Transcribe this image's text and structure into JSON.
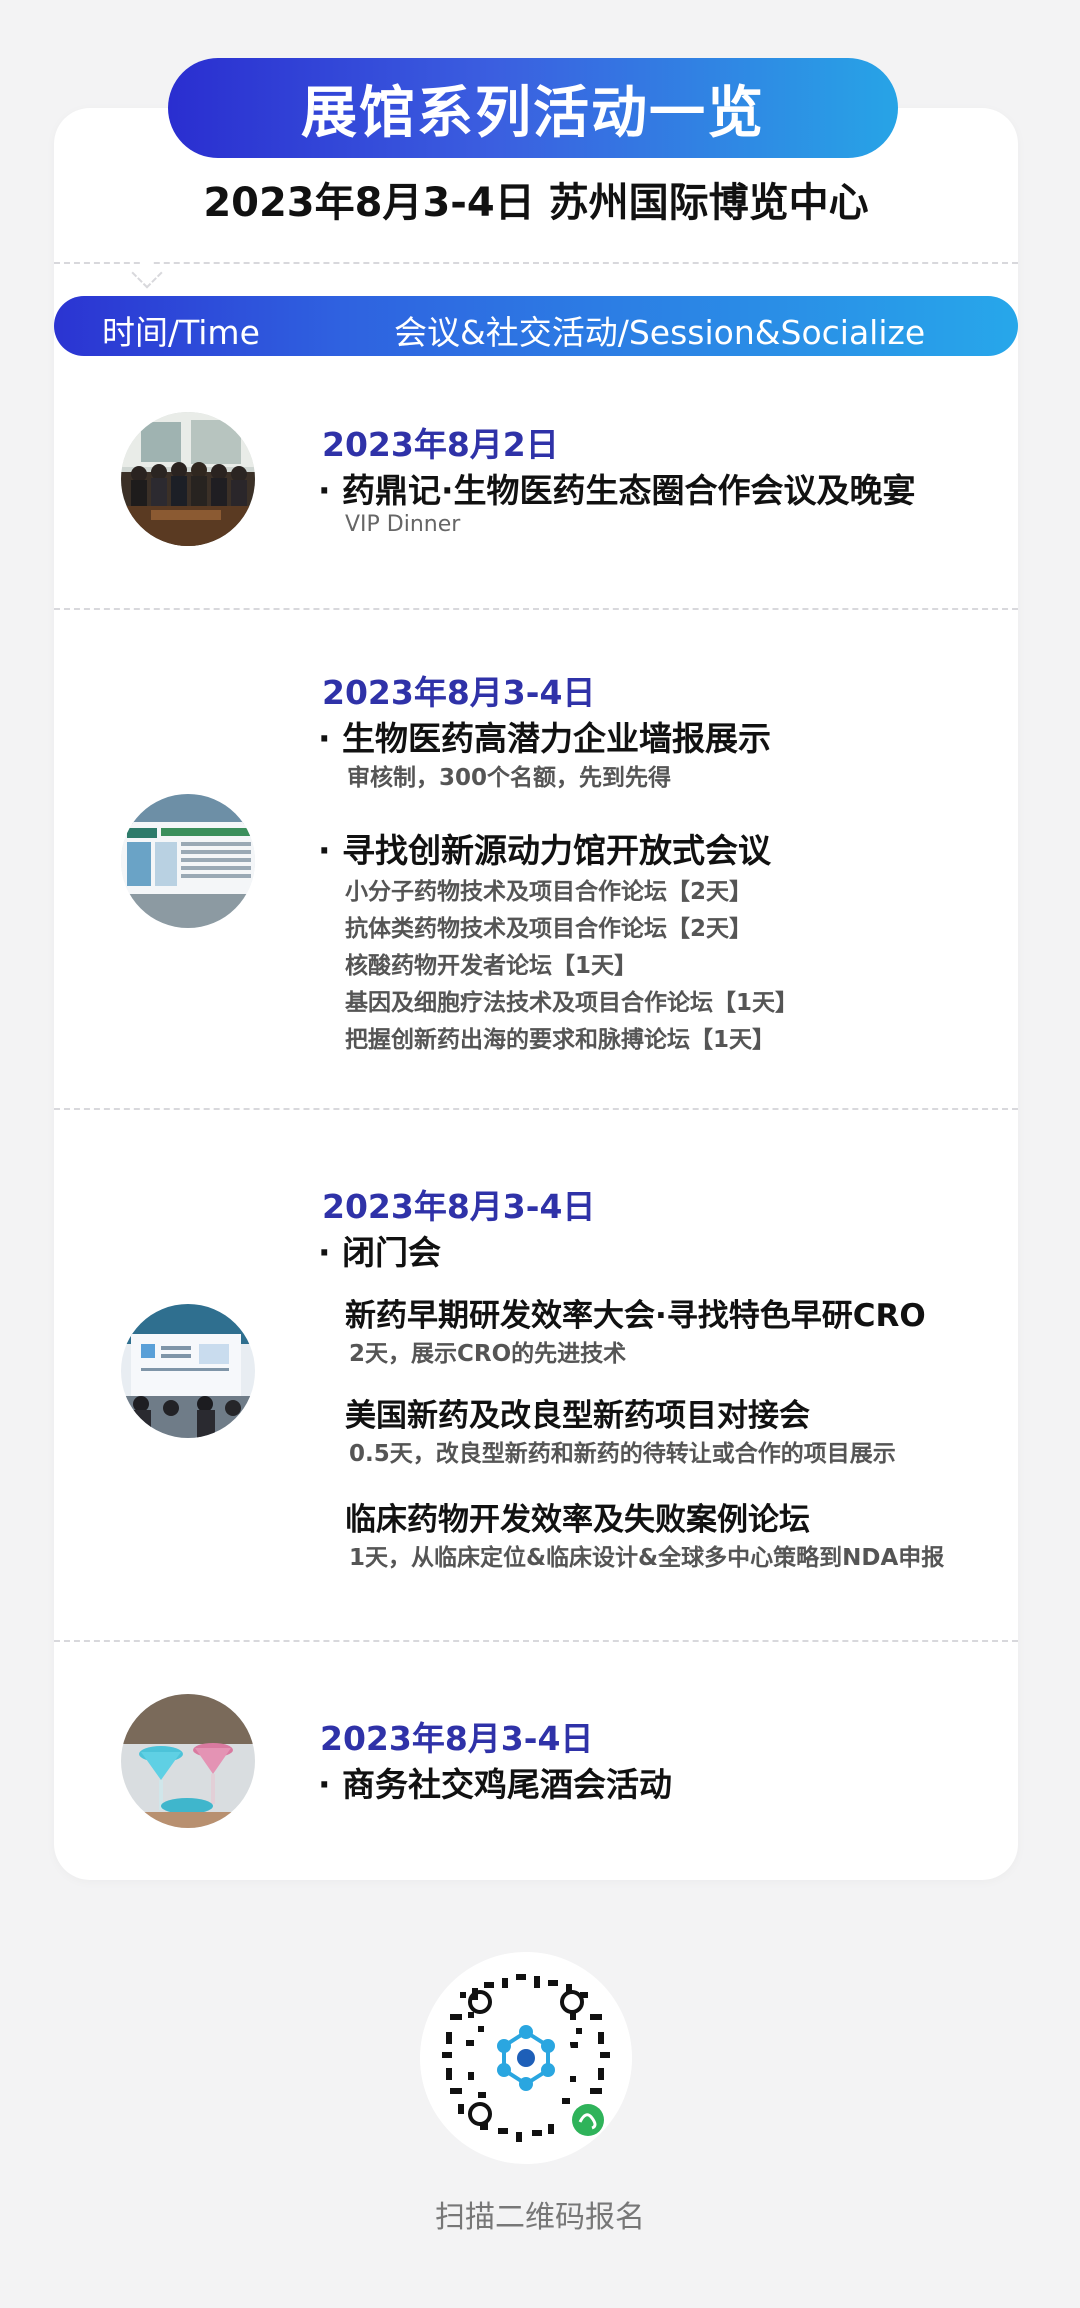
{
  "header": {
    "title": "展馆系列活动一览",
    "subtitle": "2023年8月3-4日  苏州国际博览中心",
    "col_time": "时间/Time",
    "col_session": "会议&社交活动/Session&Socialize"
  },
  "events": [
    {
      "date": "2023年8月2日",
      "title": "药鼎记·生物医药生态圈合作会议及晚宴",
      "sub": "VIP Dinner",
      "thumb_icon": "dinner-photo-icon"
    },
    {
      "date": "2023年8月3-4日",
      "title1": "生物医药高潜力企业墙报展示",
      "sub1": "审核制，300个名额，先到先得",
      "title2": "寻找创新源动力馆开放式会议",
      "forums": [
        "小分子药物技术及项目合作论坛【2天】",
        "抗体类药物技术及项目合作论坛【2天】",
        "核酸药物开发者论坛【1天】",
        "基因及细胞疗法技术及项目合作论坛【1天】",
        "把握创新药出海的要求和脉搏论坛【1天】"
      ],
      "thumb_icon": "poster-wall-photo-icon"
    },
    {
      "date": "2023年8月3-4日",
      "title": "闭门会",
      "meetings": [
        {
          "name": "新药早期研发效率大会·寻找特色早研CRO",
          "desc": "2天，展示CRO的先进技术"
        },
        {
          "name": "美国新药及改良型新药项目对接会",
          "desc": "0.5天，改良型新药和新药的待转让或合作的项目展示"
        },
        {
          "name": "临床药物开发效率及失败案例论坛",
          "desc": "1天，从临床定位&临床设计&全球多中心策略到NDA申报"
        }
      ],
      "thumb_icon": "conference-photo-icon"
    },
    {
      "date": "2023年8月3-4日",
      "title": "商务社交鸡尾酒会活动",
      "thumb_icon": "cocktail-photo-icon"
    }
  ],
  "footer": {
    "qr_icon": "mini-program-qr-icon",
    "scan_label": "扫描二维码报名"
  },
  "colors": {
    "accent_blue": "#2f32a8",
    "gradient_start": "#2a2ed0",
    "gradient_end": "#27a4e6"
  }
}
